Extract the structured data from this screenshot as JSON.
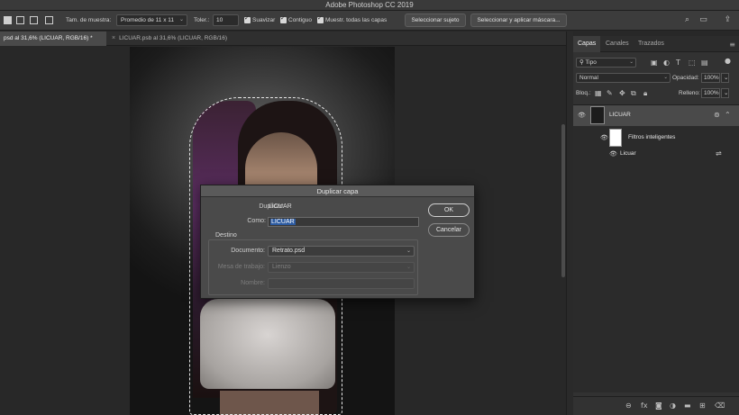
{
  "app": {
    "title": "Adobe Photoshop CC 2019"
  },
  "options_bar": {
    "sample_size_label": "Tam. de muestra:",
    "sample_size_value": "Promedio de 11 x 11",
    "tolerance_label": "Toler.:",
    "tolerance_value": "10",
    "antialias_label": "Suavizar",
    "contiguous_label": "Contiguo",
    "sample_all_label": "Muestr. todas las capas",
    "select_subject_label": "Seleccionar sujeto",
    "select_mask_label": "Seleccionar y aplicar máscara..."
  },
  "tabs": [
    {
      "label": "psd al 31,6% (LICUAR, RGB/16) *",
      "active": true
    },
    {
      "label": "LICUAR.psb al 31,6% (LICUAR, RGB/16)",
      "active": false,
      "close": "×"
    }
  ],
  "dialog": {
    "title": "Duplicar capa",
    "duplicate_label": "Duplicar:",
    "duplicate_value": "LICUAR",
    "as_label": "Como:",
    "as_value": "LICUAR",
    "destination_legend": "Destino",
    "document_label": "Documento:",
    "document_value": "Retrato.psd",
    "artboard_label": "Mesa de trabajo:",
    "artboard_value": "Lienzo",
    "name_label": "Nombre:",
    "name_value": "",
    "ok_label": "OK",
    "cancel_label": "Cancelar"
  },
  "layers_panel": {
    "tabs": [
      "Capas",
      "Canales",
      "Trazados"
    ],
    "filter_value": "Tipo",
    "blend_mode": "Normal",
    "opacity_label": "Opacidad:",
    "opacity_value": "100%",
    "lock_label": "Bloq.:",
    "fill_label": "Relleno:",
    "fill_value": "100%",
    "layers": [
      {
        "name": "LICUAR",
        "selected": true
      },
      {
        "name": "Filtros inteligentes",
        "selected": false
      },
      {
        "name": "Licuar",
        "selected": false
      }
    ]
  },
  "colors": {
    "accent_selection": "#2c5aa0",
    "panel_bg": "#323232",
    "dialog_bg": "#4a4a4a"
  }
}
